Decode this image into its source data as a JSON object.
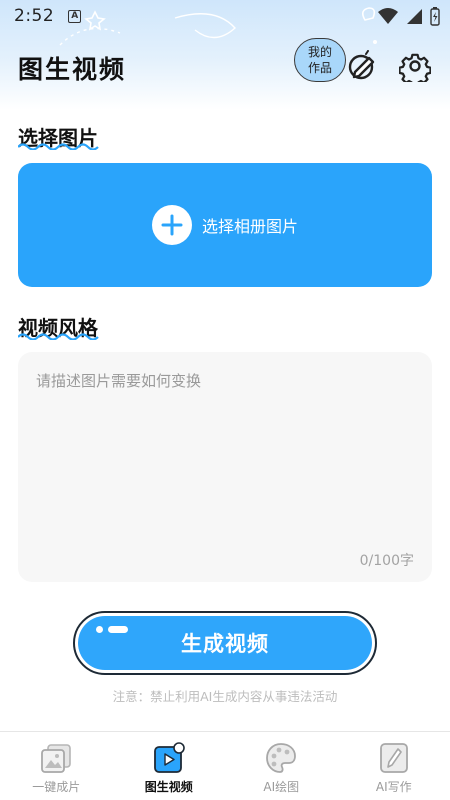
{
  "status_bar": {
    "time": "2:52",
    "notification_glyph": "A"
  },
  "header": {
    "title": "图生视频",
    "my_works_line1": "我的",
    "my_works_line2": "作品",
    "icons": [
      "edit-icon",
      "gear-icon"
    ]
  },
  "select_image": {
    "section_title": "选择图片",
    "button_label": "选择相册图片"
  },
  "video_style": {
    "section_title": "视频风格",
    "placeholder": "请描述图片需要如何变换",
    "value": "",
    "char_count": "0/100字"
  },
  "generate": {
    "label": "生成视频"
  },
  "notice": "注意：禁止利用AI生成内容从事违法活动",
  "bottom_nav": {
    "items": [
      {
        "label": "一键成片",
        "icon": "image-stack-icon",
        "active": false
      },
      {
        "label": "图生视频",
        "icon": "video-play-icon",
        "active": true
      },
      {
        "label": "AI绘图",
        "icon": "palette-icon",
        "active": false
      },
      {
        "label": "AI写作",
        "icon": "pen-icon",
        "active": false
      }
    ]
  },
  "colors": {
    "accent": "#2aa4fb",
    "header_bg": "#cfe6fb",
    "text": "#111111",
    "muted": "#9a9a9a"
  }
}
